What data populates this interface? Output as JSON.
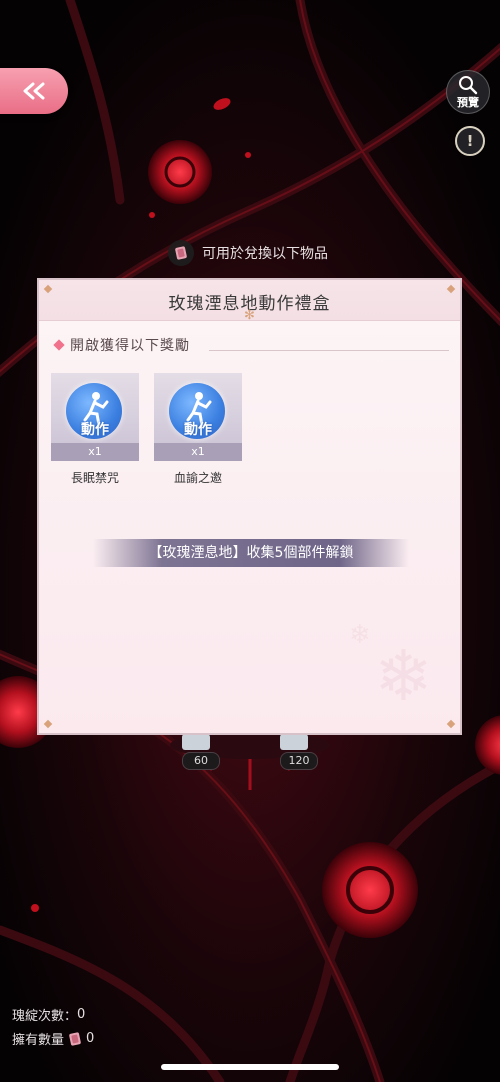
{
  "header": {
    "back_icon": "double-chevron-left-icon",
    "preview_label": "預覽",
    "preview_icon": "magnifier-icon",
    "info_icon": "exclamation-icon",
    "exchange_text": "可用於兌換以下物品"
  },
  "dialog": {
    "title": "玫瑰湮息地動作禮盒",
    "section_title": "開啟獲得以下獎勵",
    "items": [
      {
        "icon_text": "動作",
        "quantity": "x1",
        "name": "長眠禁咒"
      },
      {
        "icon_text": "動作",
        "quantity": "x1",
        "name": "血諭之邀"
      }
    ],
    "unlock_text": "【玫瑰湮息地】收集5個部件解鎖"
  },
  "background": {
    "counters": [
      "60",
      "120"
    ]
  },
  "footer": {
    "spin_label": "瑰綻次數：",
    "spin_value": "0",
    "own_label": "擁有數量",
    "own_value": "0"
  },
  "colors": {
    "accent_pink": "#e96e86",
    "bg_dark": "#0a0507",
    "rose_red": "#b3101e"
  }
}
